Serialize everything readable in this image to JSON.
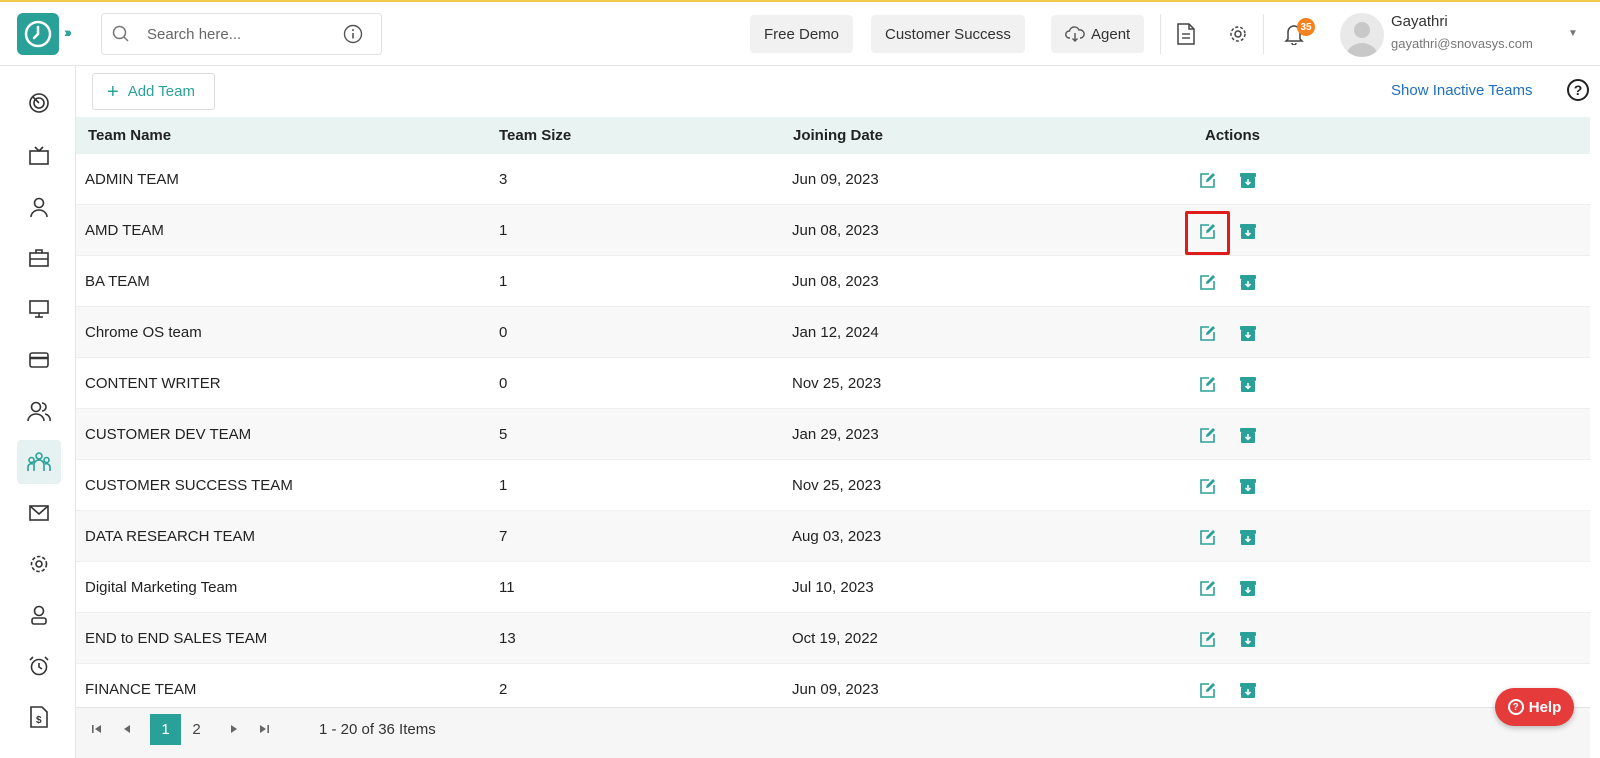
{
  "header": {
    "search_placeholder": "Search here...",
    "free_demo": "Free Demo",
    "customer_success": "Customer Success",
    "agent": "Agent",
    "notification_count": "35",
    "user_name": "Gayathri",
    "user_email": "gayathri@snovasys.com"
  },
  "colors": {
    "accent": "#2aa198",
    "highlight": "#e01b1b",
    "help": "#e53b3b",
    "link": "#1e6fc0"
  },
  "sidebar": {
    "icons": [
      "dashboard-icon",
      "tv-icon",
      "user-icon",
      "briefcase-icon",
      "monitor-icon",
      "card-icon",
      "users-icon",
      "teams-icon",
      "mail-icon",
      "settings-icon",
      "profile-icon",
      "alarm-icon",
      "invoice-icon"
    ],
    "active": "teams-icon"
  },
  "toolbar": {
    "add_team": "Add Team",
    "show_inactive": "Show Inactive Teams"
  },
  "table": {
    "headers": {
      "name": "Team Name",
      "size": "Team Size",
      "date": "Joining Date",
      "actions": "Actions"
    },
    "rows": [
      {
        "name": "ADMIN TEAM",
        "size": "3",
        "date": "Jun 09, 2023"
      },
      {
        "name": "AMD TEAM",
        "size": "1",
        "date": "Jun 08, 2023"
      },
      {
        "name": "BA TEAM",
        "size": "1",
        "date": "Jun 08, 2023"
      },
      {
        "name": "Chrome OS team",
        "size": "0",
        "date": "Jan 12, 2024"
      },
      {
        "name": "CONTENT WRITER",
        "size": "0",
        "date": "Nov 25, 2023"
      },
      {
        "name": "CUSTOMER DEV TEAM",
        "size": "5",
        "date": "Jan 29, 2023"
      },
      {
        "name": "CUSTOMER SUCCESS TEAM",
        "size": "1",
        "date": "Nov 25, 2023"
      },
      {
        "name": "DATA RESEARCH TEAM",
        "size": "7",
        "date": "Aug 03, 2023"
      },
      {
        "name": "Digital Marketing Team",
        "size": "11",
        "date": "Jul 10, 2023"
      },
      {
        "name": "END to END SALES TEAM",
        "size": "13",
        "date": "Oct 19, 2022"
      },
      {
        "name": "FINANCE TEAM",
        "size": "2",
        "date": "Jun 09, 2023"
      }
    ]
  },
  "pagination": {
    "pages": [
      "1",
      "2"
    ],
    "current": "1",
    "info": "1 - 20 of 36 Items"
  },
  "help_button": "Help"
}
